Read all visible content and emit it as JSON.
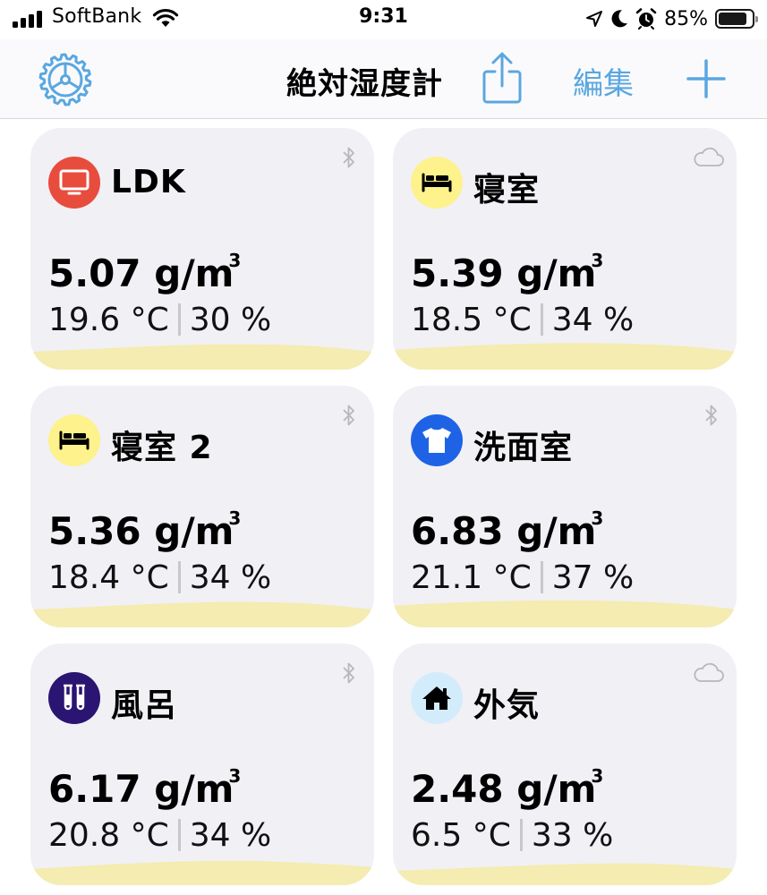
{
  "status_bar": {
    "carrier": "SoftBank",
    "time": "9:31",
    "battery": "85%",
    "battery_level": 0.85
  },
  "nav": {
    "title": "絶対湿度計",
    "edit_label": "編集"
  },
  "colors": {
    "accent": "#5aa7e0",
    "card_bg": "#f1f0f5",
    "wave": "#f4ecb0",
    "ldk_badge": "#e84c3d",
    "bedroom_badge": "#fdf28b",
    "washroom_badge": "#1e63e6",
    "bath_badge": "#2a1572",
    "outside_badge": "#d3ecfb"
  },
  "rooms": [
    {
      "name": "LDK",
      "abs": "5.07 g/m",
      "unit_sup": "3",
      "temp": "19.6 °C",
      "rh": "30 %",
      "icon": "tv-icon",
      "source": "bluetooth-icon"
    },
    {
      "name": "寝室",
      "abs": "5.39 g/m",
      "unit_sup": "3",
      "temp": "18.5 °C",
      "rh": "34 %",
      "icon": "bed-icon",
      "source": "cloud-icon"
    },
    {
      "name": "寝室 2",
      "abs": "5.36 g/m",
      "unit_sup": "3",
      "temp": "18.4 °C",
      "rh": "34 %",
      "icon": "bed-icon",
      "source": "bluetooth-icon"
    },
    {
      "name": "洗面室",
      "abs": "6.83 g/m",
      "unit_sup": "3",
      "temp": "21.1 °C",
      "rh": "37 %",
      "icon": "tshirt-icon",
      "source": "bluetooth-icon"
    },
    {
      "name": "風呂",
      "abs": "6.17 g/m",
      "unit_sup": "3",
      "temp": "20.8 °C",
      "rh": "34 %",
      "icon": "test-tubes-icon",
      "source": "bluetooth-icon"
    },
    {
      "name": "外気",
      "abs": "2.48 g/m",
      "unit_sup": "3",
      "temp": "6.5 °C",
      "rh": "33 %",
      "icon": "house-icon",
      "source": "cloud-icon"
    }
  ]
}
